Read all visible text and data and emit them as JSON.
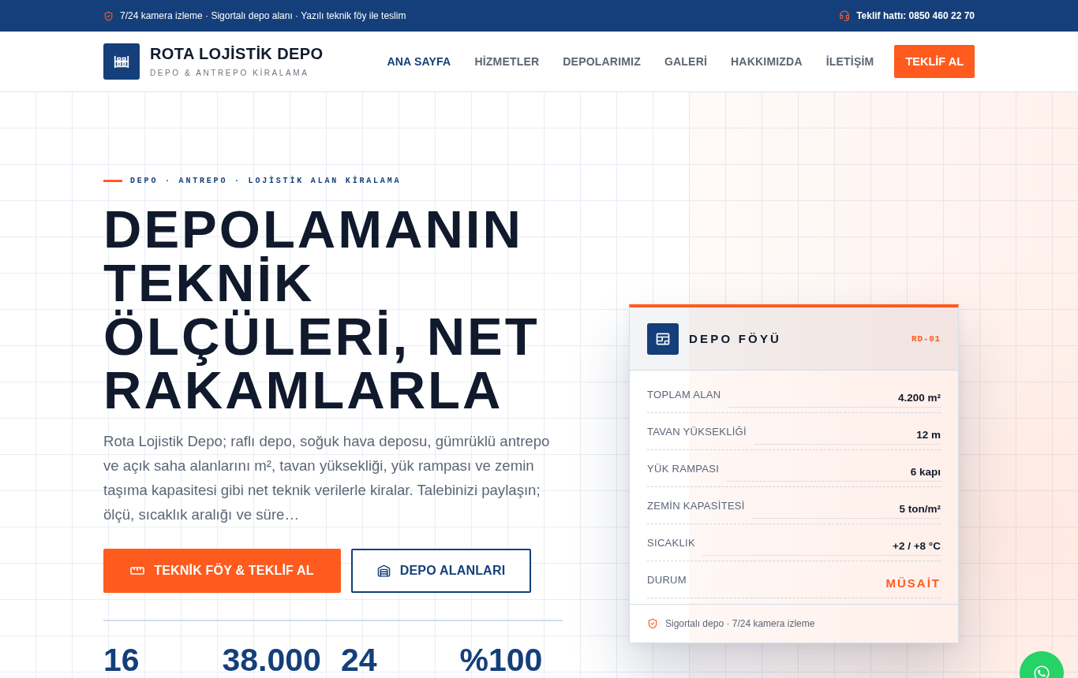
{
  "top_bar": {
    "notice": "7/24 kamera izleme · Sigortalı depo alanı · Yazılı teknik föy ile teslim",
    "hotline": "Teklif hattı: 0850 460 22 70"
  },
  "header": {
    "logo": {
      "name": "ROTA LOJİSTİK DEPO",
      "tagline": "DEPO & ANTREPO KİRALAMA"
    },
    "nav": [
      {
        "label": "ANA SAYFA",
        "selected": true
      },
      {
        "label": "HİZMETLER",
        "selected": false
      },
      {
        "label": "DEPOLARIMIZ",
        "selected": false
      },
      {
        "label": "GALERİ",
        "selected": false
      },
      {
        "label": "HAKKIMIZDA",
        "selected": false
      },
      {
        "label": "İLETİŞİM",
        "selected": false
      }
    ],
    "cta": "TEKLİF AL"
  },
  "hero": {
    "eyebrow": "DEPO · ANTREPO · LOJİSTİK ALAN KİRALAMA",
    "title": "DEPOLAMANIN TEKNİK ÖLÇÜLERİ, NET RAKAMLARLA",
    "description": "Rota Lojistik Depo; raflı depo, soğuk hava deposu, gümrüklü antrepo ve açık saha alanlarını m², tavan yüksekliği, yük rampası ve zemin taşıma kapasitesi gibi net teknik verilerle kiralar. Talebinizi paylaşın; ölçü, sıcaklık aralığı ve süre…",
    "buttons": [
      {
        "label": "TEKNİK FÖY & TEKLİF AL",
        "kind": "primary"
      },
      {
        "label": "DEPO ALANLARI",
        "kind": "outline"
      }
    ],
    "stats": [
      "16",
      "38.000",
      "24",
      "%100"
    ]
  },
  "spec_card": {
    "title": "DEPO FÖYÜ",
    "code": "RD-01",
    "rows": [
      {
        "label": "TOPLAM ALAN",
        "value": "4.200 m²",
        "kind": "spec"
      },
      {
        "label": "TAVAN YÜKSEKLİĞİ",
        "value": "12 m",
        "kind": "spec"
      },
      {
        "label": "YÜK RAMPASI",
        "value": "6 kapı",
        "kind": "spec"
      },
      {
        "label": "ZEMİN KAPASİTESİ",
        "value": "5 ton/m²",
        "kind": "spec"
      },
      {
        "label": "SICAKLIK",
        "value": "+2 / +8 °C",
        "kind": "spec"
      },
      {
        "label": "DURUM",
        "value": "MÜSAİT",
        "kind": "status"
      }
    ],
    "footer": "Sigortalı depo · 7/24 kamera izleme"
  }
}
